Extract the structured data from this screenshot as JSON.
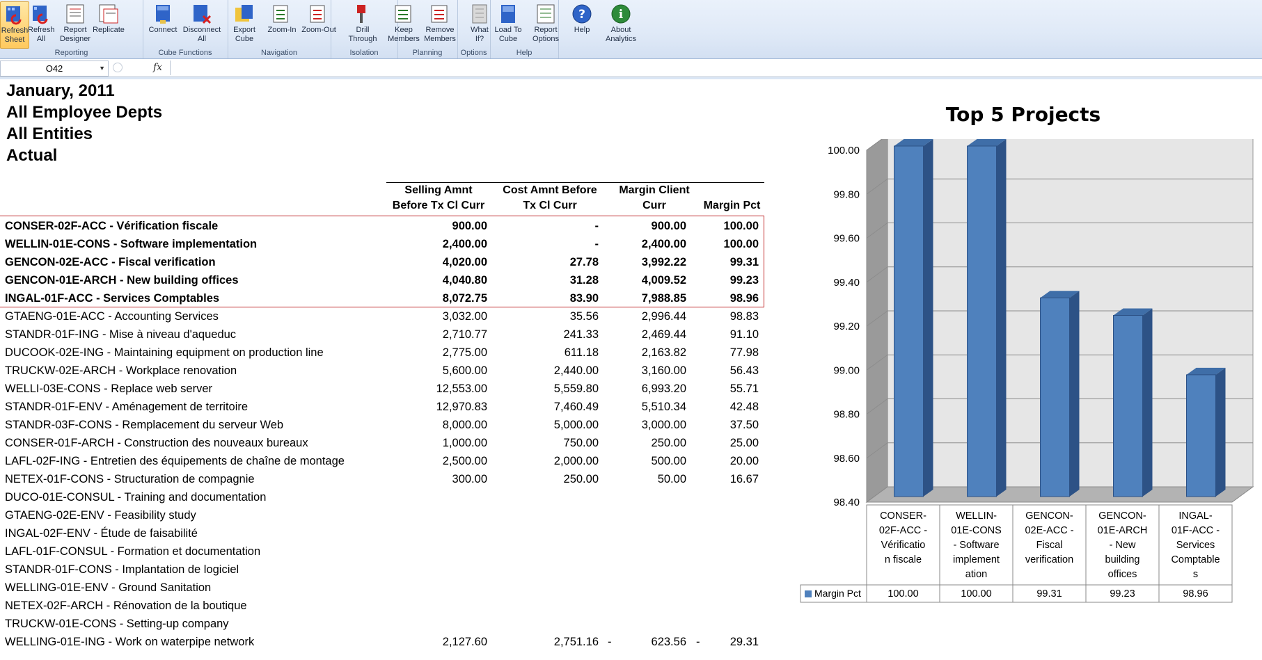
{
  "ribbon": {
    "buttons": [
      {
        "id": "refresh-sheet",
        "label": "Refresh\nSheet",
        "active": true
      },
      {
        "id": "refresh-all",
        "label": "Refresh\nAll"
      },
      {
        "id": "report-designer",
        "label": "Report\nDesigner"
      },
      {
        "id": "replicate",
        "label": "Replicate"
      },
      {
        "id": "connect",
        "label": "Connect"
      },
      {
        "id": "disconnect-all",
        "label": "Disconnect\nAll"
      },
      {
        "id": "export-cube",
        "label": "Export\nCube"
      },
      {
        "id": "zoom-in",
        "label": "Zoom-In"
      },
      {
        "id": "zoom-out",
        "label": "Zoom-Out"
      },
      {
        "id": "drill-through",
        "label": "Drill\nThrough"
      },
      {
        "id": "keep-members",
        "label": "Keep\nMembers"
      },
      {
        "id": "remove-members",
        "label": "Remove\nMembers"
      },
      {
        "id": "what-if",
        "label": "What\nIf?"
      },
      {
        "id": "load-to-cube",
        "label": "Load To\nCube"
      },
      {
        "id": "report-options",
        "label": "Report\nOptions"
      },
      {
        "id": "help",
        "label": "Help"
      },
      {
        "id": "about-analytics",
        "label": "About\nAnalytics"
      }
    ],
    "groups": [
      "Reporting",
      "Cube Functions",
      "Navigation",
      "Isolation",
      "Planning",
      "Options",
      "Help"
    ]
  },
  "formula_bar": {
    "cell_ref": "O42",
    "fx": "fx",
    "value": ""
  },
  "report_header": {
    "line1": "January, 2011",
    "line2": "All Employee Depts",
    "line3": "All Entities",
    "line4": "Actual"
  },
  "table": {
    "columns": [
      {
        "line1": "Selling Amnt",
        "line2": "Before Tx Cl Curr"
      },
      {
        "line1": "Cost Amnt Before",
        "line2": "Tx Cl Curr"
      },
      {
        "line1": "Margin Client",
        "line2": "Curr"
      },
      {
        "line1": "",
        "line2": "Margin Pct"
      }
    ],
    "rows": [
      {
        "name": "CONSER-02F-ACC - Vérification fiscale",
        "selling": "900.00",
        "cost": "-",
        "margin": "900.00",
        "pct": "100.00",
        "top": true
      },
      {
        "name": "WELLIN-01E-CONS - Software implementation",
        "selling": "2,400.00",
        "cost": "-",
        "margin": "2,400.00",
        "pct": "100.00",
        "top": true
      },
      {
        "name": "GENCON-02E-ACC - Fiscal verification",
        "selling": "4,020.00",
        "cost": "27.78",
        "margin": "3,992.22",
        "pct": "99.31",
        "top": true
      },
      {
        "name": "GENCON-01E-ARCH - New building offices",
        "selling": "4,040.80",
        "cost": "31.28",
        "margin": "4,009.52",
        "pct": "99.23",
        "top": true
      },
      {
        "name": "INGAL-01F-ACC - Services Comptables",
        "selling": "8,072.75",
        "cost": "83.90",
        "margin": "7,988.85",
        "pct": "98.96",
        "top": true
      },
      {
        "name": "GTAENG-01E-ACC - Accounting Services",
        "selling": "3,032.00",
        "cost": "35.56",
        "margin": "2,996.44",
        "pct": "98.83"
      },
      {
        "name": "STANDR-01F-ING - Mise à niveau d'aqueduc",
        "selling": "2,710.77",
        "cost": "241.33",
        "margin": "2,469.44",
        "pct": "91.10"
      },
      {
        "name": "DUCOOK-02E-ING - Maintaining equipment on production line",
        "selling": "2,775.00",
        "cost": "611.18",
        "margin": "2,163.82",
        "pct": "77.98"
      },
      {
        "name": "TRUCKW-02E-ARCH - Workplace renovation",
        "selling": "5,600.00",
        "cost": "2,440.00",
        "margin": "3,160.00",
        "pct": "56.43"
      },
      {
        "name": "WELLI-03E-CONS - Replace web server",
        "selling": "12,553.00",
        "cost": "5,559.80",
        "margin": "6,993.20",
        "pct": "55.71"
      },
      {
        "name": "STANDR-01F-ENV - Aménagement de territoire",
        "selling": "12,970.83",
        "cost": "7,460.49",
        "margin": "5,510.34",
        "pct": "42.48"
      },
      {
        "name": "STANDR-03F-CONS - Remplacement du serveur Web",
        "selling": "8,000.00",
        "cost": "5,000.00",
        "margin": "3,000.00",
        "pct": "37.50"
      },
      {
        "name": "CONSER-01F-ARCH - Construction des nouveaux bureaux",
        "selling": "1,000.00",
        "cost": "750.00",
        "margin": "250.00",
        "pct": "25.00"
      },
      {
        "name": "LAFL-02F-ING - Entretien des équipements de chaîne de montage",
        "selling": "2,500.00",
        "cost": "2,000.00",
        "margin": "500.00",
        "pct": "20.00"
      },
      {
        "name": "NETEX-01F-CONS - Structuration de compagnie",
        "selling": "300.00",
        "cost": "250.00",
        "margin": "50.00",
        "pct": "16.67"
      },
      {
        "name": "DUCO-01E-CONSUL - Training and documentation",
        "selling": "",
        "cost": "",
        "margin": "",
        "pct": ""
      },
      {
        "name": "GTAENG-02E-ENV - Feasibility study",
        "selling": "",
        "cost": "",
        "margin": "",
        "pct": ""
      },
      {
        "name": "INGAL-02F-ENV - Étude de faisabilité",
        "selling": "",
        "cost": "",
        "margin": "",
        "pct": ""
      },
      {
        "name": "LAFL-01F-CONSUL - Formation et documentation",
        "selling": "",
        "cost": "",
        "margin": "",
        "pct": ""
      },
      {
        "name": "STANDR-01F-CONS - Implantation de logiciel",
        "selling": "",
        "cost": "",
        "margin": "",
        "pct": ""
      },
      {
        "name": "WELLING-01E-ENV - Ground Sanitation",
        "selling": "",
        "cost": "",
        "margin": "",
        "pct": ""
      },
      {
        "name": "NETEX-02F-ARCH - Rénovation de la boutique",
        "selling": "",
        "cost": "",
        "margin": "",
        "pct": ""
      },
      {
        "name": "TRUCKW-01E-CONS - Setting-up company",
        "selling": "",
        "cost": "",
        "margin": "",
        "pct": ""
      },
      {
        "name": "WELLING-01E-ING - Work on waterpipe network",
        "selling": "2,127.60",
        "cost": "2,751.16",
        "margin": "623.56",
        "pct": "29.31",
        "neg_margin": "-",
        "neg_pct": "-"
      }
    ]
  },
  "chart_data": {
    "type": "bar",
    "title": "Top 5 Projects",
    "categories": [
      "CONSER-02F-ACC - Vérification fiscale",
      "WELLIN-01E-CONS - Software implementation",
      "GENCON-02E-ACC - Fiscal verification",
      "GENCON-01E-ARCH - New building offices",
      "INGAL-01F-ACC - Services Comptables"
    ],
    "category_lines": [
      [
        "CONSER-",
        "02F-ACC -",
        "Vérificatio",
        "n fiscale"
      ],
      [
        "WELLIN-",
        "01E-CONS",
        "- Software",
        "implement",
        "ation"
      ],
      [
        "GENCON-",
        "02E-ACC -",
        "Fiscal",
        "verification"
      ],
      [
        "GENCON-",
        "01E-ARCH",
        "- New",
        "building",
        "offices"
      ],
      [
        "INGAL-",
        "01F-ACC -",
        "Services",
        "Comptable",
        "s"
      ]
    ],
    "series": [
      {
        "name": "Margin Pct",
        "values": [
          100.0,
          100.0,
          99.31,
          99.23,
          98.96
        ],
        "color": "#4f81bd"
      }
    ],
    "value_labels": [
      "100.00",
      "100.00",
      "99.31",
      "99.23",
      "98.96"
    ],
    "ylim": [
      98.4,
      100.0
    ],
    "yticks": [
      "100.00",
      "99.80",
      "99.60",
      "99.40",
      "99.20",
      "99.00",
      "98.80",
      "98.60",
      "98.40"
    ],
    "grid": true,
    "legend": "data table"
  }
}
